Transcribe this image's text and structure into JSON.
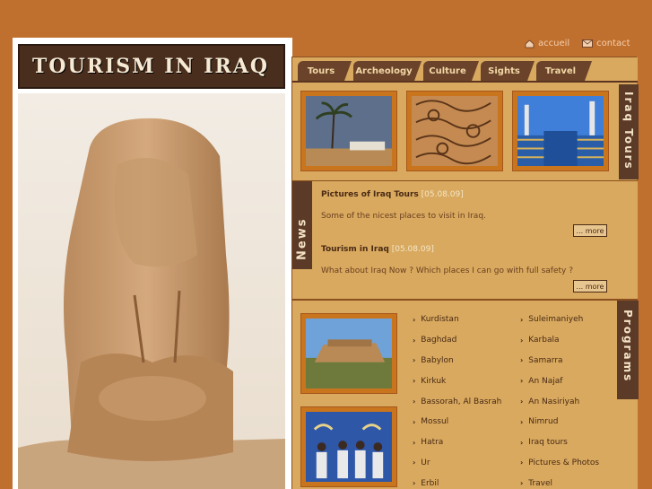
{
  "site": {
    "logo_text": "TOURISM IN IRAQ"
  },
  "toplinks": {
    "accueil": "accueil",
    "contact": "contact"
  },
  "nav": {
    "tabs": [
      "Tours",
      "Archeology",
      "Culture",
      "Sights",
      "Travel"
    ]
  },
  "sections": {
    "tours_label": "Iraq Tours",
    "news_label": "News",
    "programs_label": "Programs"
  },
  "news": [
    {
      "title": "Pictures of Iraq Tours",
      "date": "[05.08.09]",
      "desc": "Some of the nicest places to visit in Iraq.",
      "more": "... more"
    },
    {
      "title": "Tourism in Iraq",
      "date": "[05.08.09]",
      "desc": "What about Iraq Now ? Which places I can go with full safety ?",
      "more": "... more"
    }
  ],
  "programs": {
    "col1": [
      "Kurdistan",
      "Baghdad",
      "Babylon",
      "Kirkuk",
      "Bassorah, Al Basrah",
      "Mossul",
      "Hatra",
      "Ur",
      "Erbil"
    ],
    "col2": [
      "Suleimaniyeh",
      "Karbala",
      "Samarra",
      "An Najaf",
      "An Nasiriyah",
      "Nimrud",
      "Iraq tours",
      "Pictures & Photos",
      "Travel"
    ]
  },
  "colors": {
    "background": "#c0702e",
    "panel": "#d8a95f",
    "dark": "#5b3a28"
  }
}
